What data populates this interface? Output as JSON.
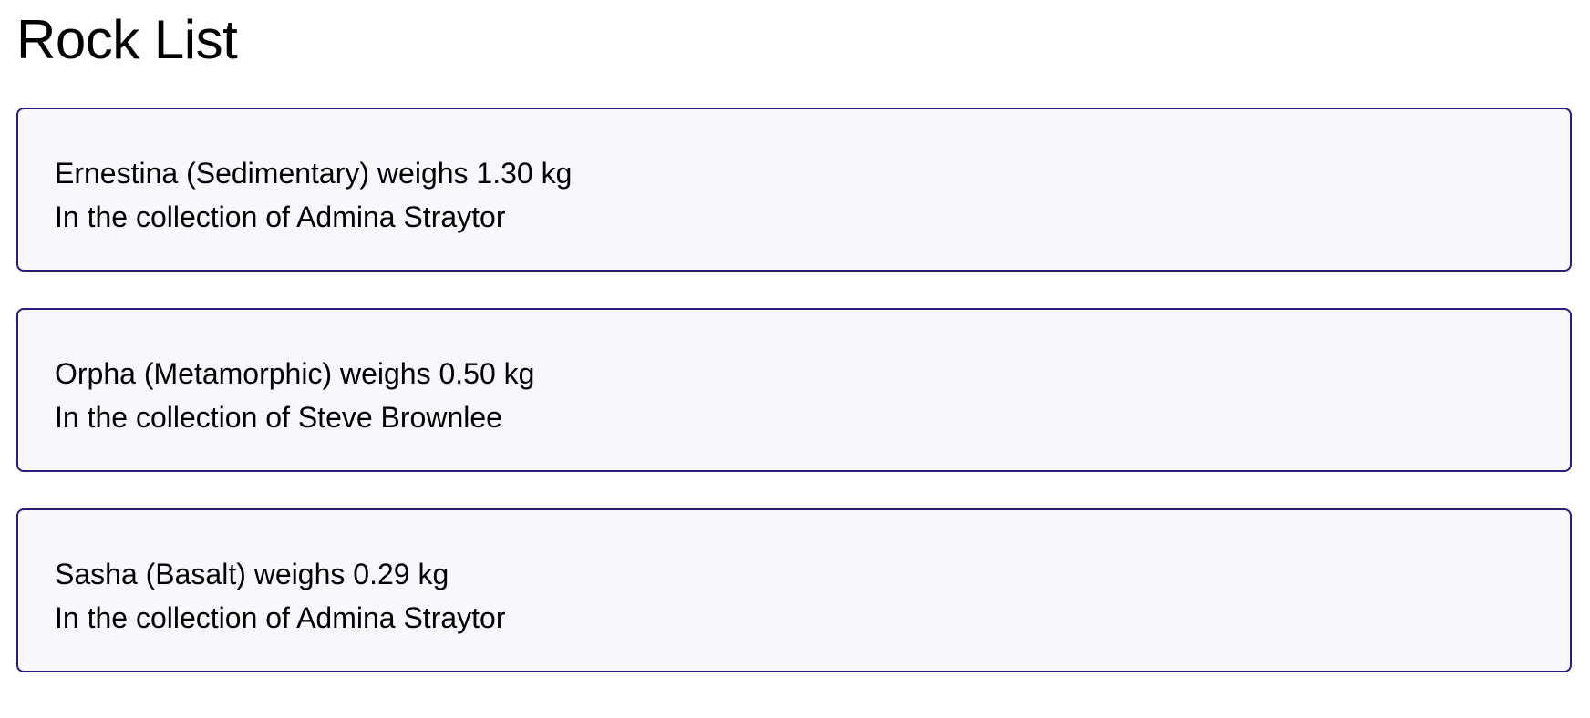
{
  "page": {
    "title": "Rock List"
  },
  "colors": {
    "card_border": "#2e1a7a",
    "card_background": "#f7f8fb",
    "text": "#000000"
  },
  "rocks": [
    {
      "summary": "Ernestina (Sedimentary) weighs 1.30 kg",
      "collection": "In the collection of Admina Straytor"
    },
    {
      "summary": "Orpha (Metamorphic) weighs 0.50 kg",
      "collection": "In the collection of Steve Brownlee"
    },
    {
      "summary": "Sasha (Basalt) weighs 0.29 kg",
      "collection": "In the collection of Admina Straytor"
    }
  ]
}
